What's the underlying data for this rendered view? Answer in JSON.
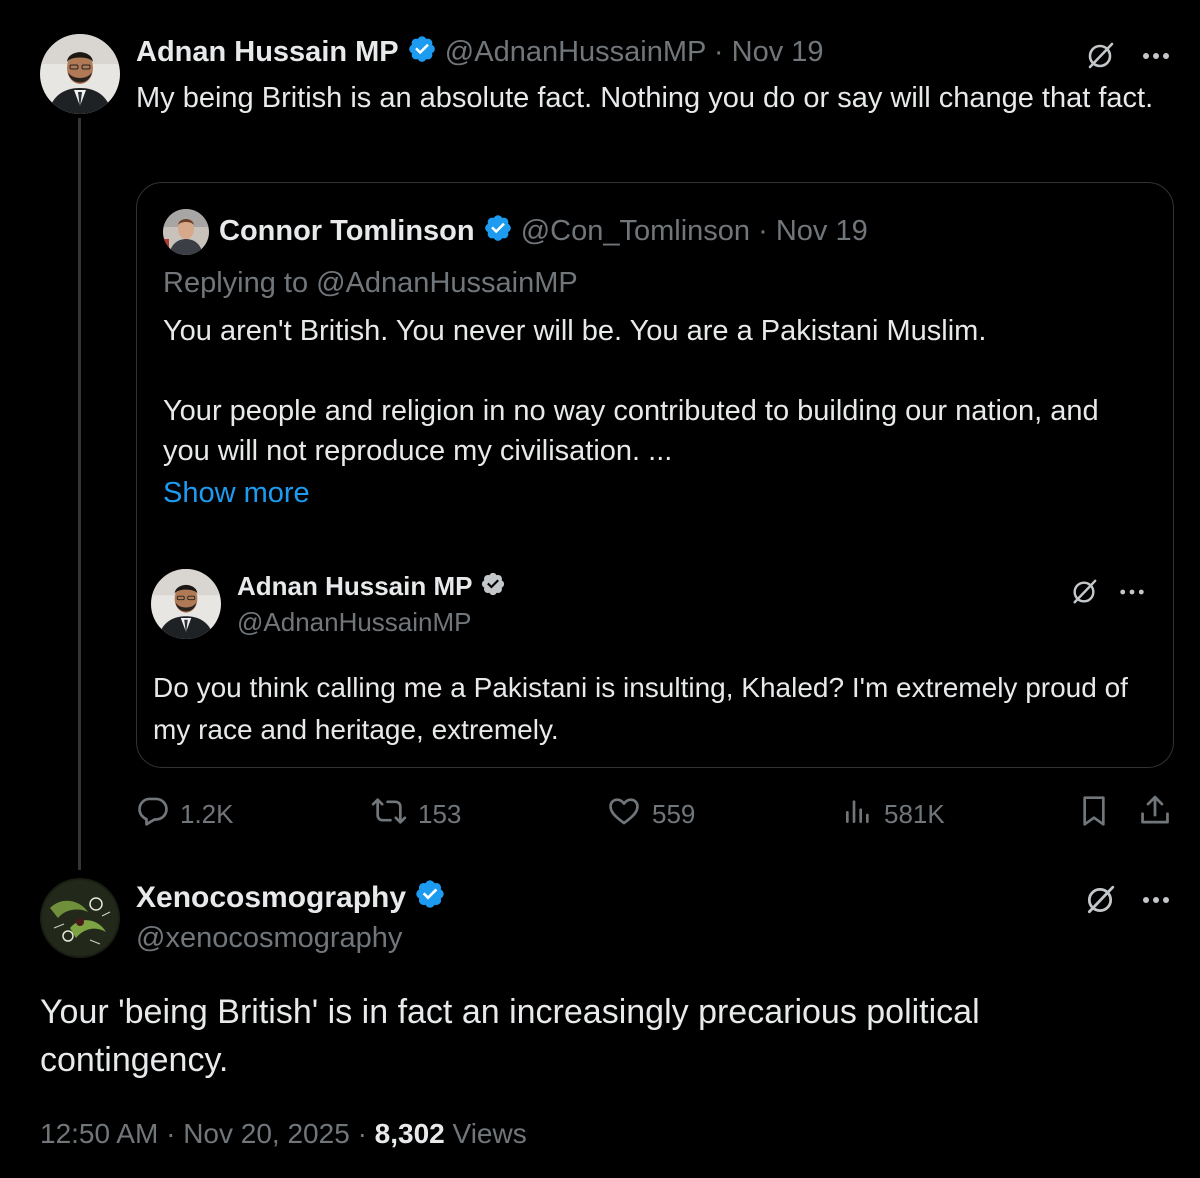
{
  "main_tweet": {
    "display_name": "Adnan Hussain MP",
    "handle": "@AdnanHussainMP",
    "separator": "·",
    "date": "Nov 19",
    "text": "My being British is an absolute fact. Nothing you do or say will change that fact."
  },
  "quoted_tweet": {
    "display_name": "Connor Tomlinson",
    "handle": "@Con_Tomlinson",
    "separator": "·",
    "date": "Nov 19",
    "replying_to": "Replying to @AdnanHussainMP",
    "paragraph_1": "You aren't British. You never will be. You are a Pakistani Muslim.",
    "paragraph_2": "Your people and religion in no way contributed to building our nation, and you will not reproduce my civilisation. ...",
    "show_more": "Show more",
    "embedded": {
      "display_name": "Adnan Hussain MP",
      "handle": "@AdnanHussainMP",
      "text": "Do you think calling me a Pakistani is insulting, Khaled? I'm extremely proud of my race and heritage, extremely."
    }
  },
  "actions": {
    "replies": "1.2K",
    "reposts": "153",
    "likes": "559",
    "views": "581K"
  },
  "reply_tweet": {
    "display_name": "Xenocosmography",
    "handle": "@xenocosmography",
    "text": "Your 'being British' is in fact an increasingly precarious political contingency.",
    "time": "12:50 AM",
    "date": "Nov 20, 2025",
    "separator": "·",
    "view_count": "8,302",
    "views_label": "Views"
  },
  "icons": {
    "verified": "verified-badge-icon",
    "grok": "grok-icon",
    "more": "more-icon",
    "reply": "reply-icon",
    "repost": "repost-icon",
    "like": "like-icon",
    "views": "views-icon",
    "bookmark": "bookmark-icon",
    "share": "share-icon"
  },
  "colors": {
    "background": "#000000",
    "text": "#e7e9ea",
    "muted": "#71767b",
    "link": "#1d9bf0",
    "border": "#2f3336",
    "verified": "#1d9bf0"
  }
}
